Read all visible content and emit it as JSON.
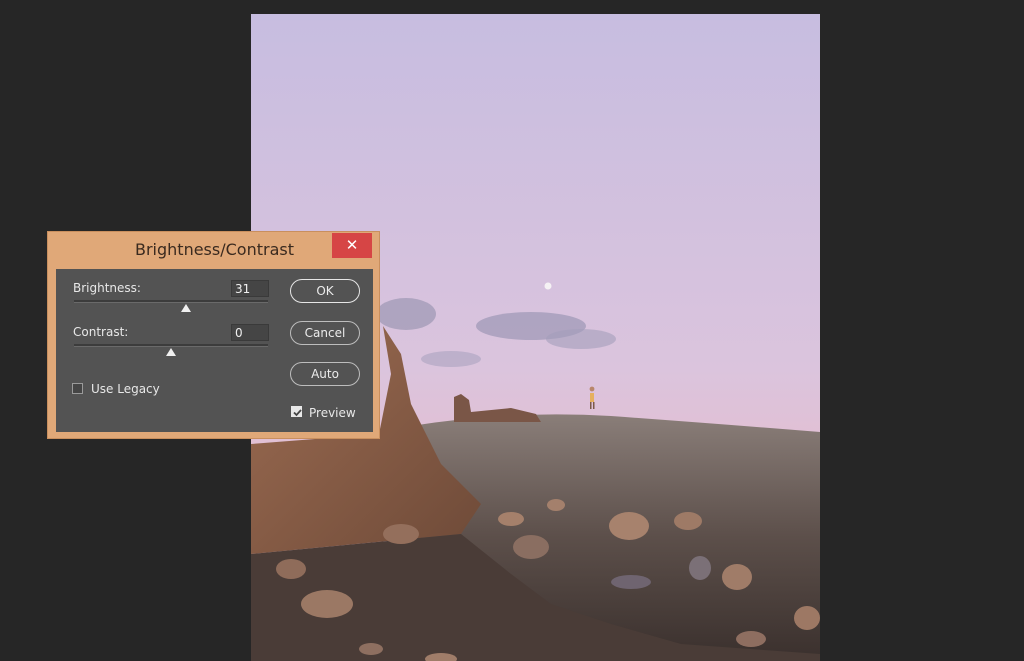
{
  "dialog": {
    "title": "Brightness/Contrast",
    "close_glyph": "✕",
    "brightness": {
      "label": "Brightness:",
      "value": "31",
      "slider_fraction": 0.575
    },
    "contrast": {
      "label": "Contrast:",
      "value": "0",
      "slider_fraction": 0.5
    },
    "use_legacy": {
      "label": "Use Legacy",
      "checked": false
    },
    "preview": {
      "label": "Preview",
      "checked": true
    },
    "buttons": {
      "ok": "OK",
      "cancel": "Cancel",
      "auto": "Auto"
    },
    "colors": {
      "frame": "#e0a878",
      "body": "#535353",
      "close": "#d64545"
    }
  },
  "icons": {
    "close": "close-icon",
    "check": "checkmark-icon"
  }
}
